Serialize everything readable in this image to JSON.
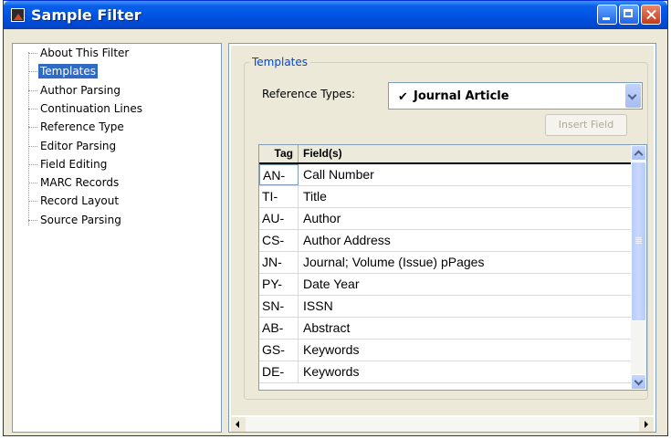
{
  "window": {
    "title": "Sample Filter"
  },
  "tree": {
    "items": [
      {
        "label": "About This Filter"
      },
      {
        "label": "Templates",
        "selected": true
      },
      {
        "label": "Author Parsing"
      },
      {
        "label": "Continuation Lines"
      },
      {
        "label": "Reference Type"
      },
      {
        "label": "Editor Parsing"
      },
      {
        "label": "Field Editing"
      },
      {
        "label": "MARC Records"
      },
      {
        "label": "Record Layout"
      },
      {
        "label": "Source Parsing"
      }
    ]
  },
  "templates": {
    "group_label": "Templates",
    "ref_types_label": "Reference Types:",
    "ref_type_check": "✔",
    "ref_type_value": "Journal Article",
    "insert_field_label": "Insert Field",
    "columns": {
      "tag": "Tag",
      "fields": "Field(s)"
    },
    "rows": [
      {
        "tag": "AN-",
        "field": "Call Number"
      },
      {
        "tag": "TI-",
        "field": "Title"
      },
      {
        "tag": "AU-",
        "field": "Author"
      },
      {
        "tag": "CS-",
        "field": "Author Address"
      },
      {
        "tag": "JN-",
        "field": "Journal; Volume (Issue) pPages"
      },
      {
        "tag": "PY-",
        "field": "Date Year"
      },
      {
        "tag": "SN-",
        "field": "ISSN"
      },
      {
        "tag": "AB-",
        "field": "Abstract"
      },
      {
        "tag": "GS-",
        "field": "Keywords"
      },
      {
        "tag": "DE-",
        "field": "Keywords"
      }
    ]
  },
  "icons": {
    "app": "filter-app-icon",
    "minimize": "minimize-icon",
    "maximize": "maximize-icon",
    "close": "close-icon"
  },
  "colors": {
    "title_bar": "#0055e5",
    "selection": "#316ac5",
    "group_label": "#0046d5",
    "dialog_bg": "#ece9d8"
  }
}
